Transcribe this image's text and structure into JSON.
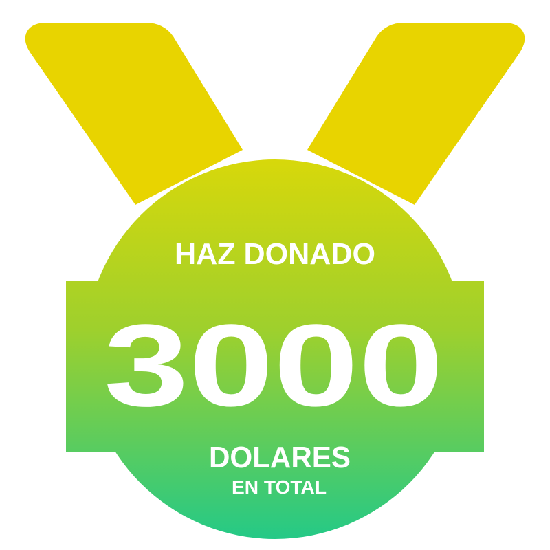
{
  "badge": {
    "intro_text": "HAZ DONADO",
    "amount": "3000",
    "unit_text": "DOLARES",
    "suffix_text": "EN TOTAL"
  },
  "colors": {
    "ribbon": "#e8d400",
    "gradient_top": "#d8d80a",
    "gradient_bottom": "#24c987",
    "text": "#ffffff",
    "background": "#ffffff"
  }
}
